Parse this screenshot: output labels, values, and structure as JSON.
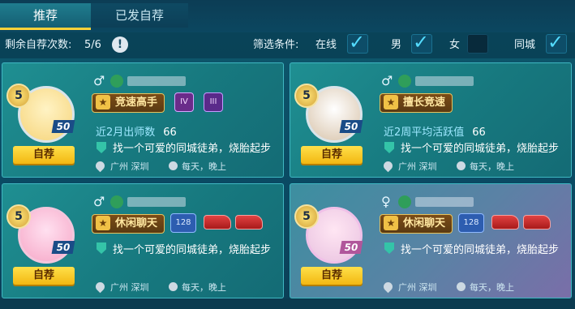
{
  "tabs": [
    {
      "label": "推荐"
    },
    {
      "label": "已发自荐"
    }
  ],
  "filter": {
    "remaining_label": "剩余自荐次数:",
    "remaining_value": "5/6",
    "filter_label": "筛选条件:",
    "options": [
      {
        "label": "在线",
        "checked": true
      },
      {
        "label": "男",
        "checked": true
      },
      {
        "label": "女",
        "checked": false
      },
      {
        "label": "同城",
        "checked": true
      }
    ]
  },
  "cards": [
    {
      "gender": "♂",
      "level": "5",
      "score": "50",
      "tag": "竞速高手",
      "badges": [
        "IV",
        "III"
      ],
      "stat_label": "近2月出师数",
      "stat_value": "66",
      "desc": "找一个可爱的同城徒弟，烧胎起步",
      "city": "广州  深圳",
      "time": "每天，晚上",
      "button": "自荐"
    },
    {
      "gender": "♂",
      "level": "5",
      "score": "50",
      "tag": "擅长竞速",
      "badges": [],
      "stat_label": "近2周平均活跃值",
      "stat_value": "66",
      "desc": "找一个可爱的同城徒弟，烧胎起步",
      "city": "广州  深圳",
      "time": "每天，晚上",
      "button": "自荐"
    },
    {
      "gender": "♂",
      "level": "5",
      "score": "50",
      "tag": "休闲聊天",
      "badges": [
        "128"
      ],
      "stat_label": "",
      "stat_value": "",
      "desc": "找一个可爱的同城徒弟，烧胎起步",
      "city": "广州  深圳",
      "time": "每天，晚上",
      "button": "自荐"
    },
    {
      "gender": "♀",
      "level": "5",
      "score": "50",
      "tag": "休闲聊天",
      "badges": [
        "128"
      ],
      "stat_label": "",
      "stat_value": "",
      "desc": "找一个可爱的同城徒弟，烧胎起步",
      "city": "广州  深圳",
      "time": "每天，晚上",
      "button": "自荐"
    }
  ],
  "icons": {
    "info": "info-icon",
    "check": "check-icon",
    "location": "location-pin-icon",
    "clock": "clock-icon",
    "flag": "flag-icon",
    "car": "race-car-icon"
  }
}
